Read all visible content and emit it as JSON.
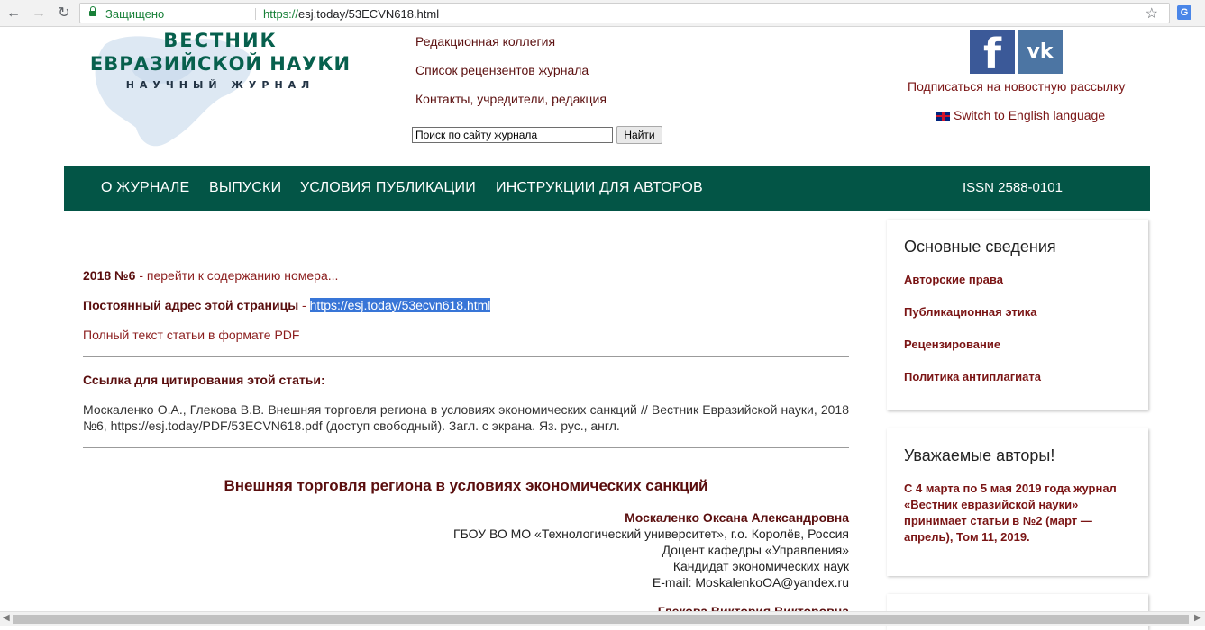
{
  "browser": {
    "secure_label": "Защищено",
    "url_scheme": "https://",
    "url_rest": "esj.today/53ECVN618.html"
  },
  "logo": {
    "line1": "ВЕСТНИК",
    "line2": "ЕВРАЗИЙСКОЙ НАУКИ",
    "line3": "НАУЧНЫЙ ЖУРНАЛ"
  },
  "top_links": [
    "Редакционная коллегия",
    "Список рецензентов журнала",
    "Контакты, учредители, редакция"
  ],
  "search": {
    "value": "Поиск по сайту журнала",
    "button": "Найти"
  },
  "social": {
    "fb": "f",
    "vk": "vk",
    "subscribe": "Подписаться на новостную рассылку",
    "switch_lang": "Switch to English language"
  },
  "nav": {
    "items": [
      "О ЖУРНАЛЕ",
      "ВЫПУСКИ",
      "УСЛОВИЯ ПУБЛИКАЦИИ",
      "ИНСТРУКЦИИ ДЛЯ АВТОРОВ"
    ],
    "issn": "ISSN 2588-0101"
  },
  "article": {
    "issue": "2018 №6",
    "issue_sep": " - ",
    "issue_link": "перейти к содержанию номера...",
    "permalink_label": "Постоянный адрес этой страницы",
    "permalink_sep": " - ",
    "permalink": "https://esj.today/53ecvn618.html",
    "pdf_link": "Полный текст статьи в формате PDF",
    "cite_label": "Ссылка для цитирования этой статьи:",
    "cite_text": "Москаленко О.А., Глекова В.В. Внешняя торговля региона в условиях экономических санкций // Вестник Евразийской науки, 2018 №6, https://esj.today/PDF/53ECVN618.pdf (доступ свободный). Загл. с экрана. Яз. рус., англ.",
    "title": "Внешняя торговля региона в условиях экономических санкций",
    "author_name": "Москаленко Оксана Александровна",
    "author_lines": [
      "ГБОУ ВО МО «Технологический университет», г.о. Королёв, Россия",
      "Доцент кафедры «Управления»",
      "Кандидат экономических наук",
      "E-mail: MoskalenkoOA@yandex.ru"
    ],
    "next_author": "Глекова Виктория Викторовна"
  },
  "sidebar": {
    "box1_title": "Основные сведения",
    "box1_links": [
      "Авторские права",
      "Публикационная этика",
      "Рецензирование",
      "Политика антиплагиата"
    ],
    "box2_title": "Уважаемые авторы!",
    "box2_note": "С 4 марта по 5 мая 2019 года журнал «Вестник евразийской науки» принимает статьи в №2 (март — апрель), Том 11, 2019."
  },
  "colors": {
    "nav_green": "#035546",
    "logo_green": "#07604d",
    "link_red": "#7a1414",
    "dark_red": "#5a0e0e"
  }
}
